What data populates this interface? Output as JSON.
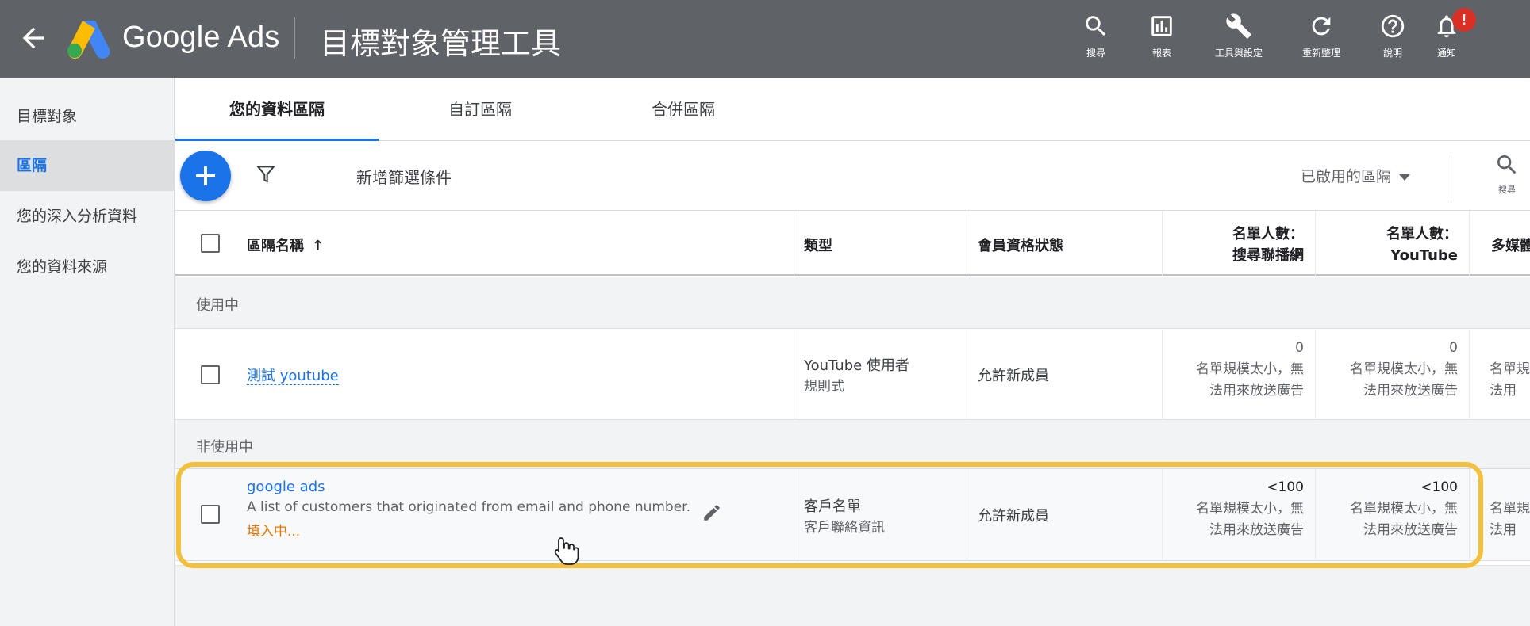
{
  "header": {
    "product": "Google Ads",
    "page_title": "目標對象管理工具",
    "tools": [
      {
        "label": "搜尋",
        "icon": "search-icon"
      },
      {
        "label": "報表",
        "icon": "reports-icon"
      },
      {
        "label": "工具與設定",
        "icon": "wrench-icon"
      },
      {
        "label": "重新整理",
        "icon": "refresh-icon"
      },
      {
        "label": "說明",
        "icon": "help-icon"
      },
      {
        "label": "通知",
        "icon": "bell-icon"
      }
    ],
    "notification_badge": "!"
  },
  "sidebar": {
    "items": [
      {
        "label": "目標對象",
        "active": false
      },
      {
        "label": "區隔",
        "active": true
      },
      {
        "label": "您的深入分析資料",
        "active": false
      },
      {
        "label": "您的資料來源",
        "active": false
      }
    ]
  },
  "tabs": [
    {
      "label": "您的資料區隔",
      "active": true
    },
    {
      "label": "自訂區隔",
      "active": false
    },
    {
      "label": "合併區隔",
      "active": false
    }
  ],
  "toolbar": {
    "add_filter_label": "新增篩選條件",
    "segment_filter": "已啟用的區隔",
    "search_label": "搜尋"
  },
  "table": {
    "columns": {
      "name": "區隔名稱",
      "type": "類型",
      "membership": "會員資格狀態",
      "size_search_line1": "名單人數：",
      "size_search_line2": "搜尋聯播網",
      "size_youtube_line1": "名單人數：",
      "size_youtube_line2": "YouTube",
      "size_display": "多媒體"
    },
    "groups": [
      {
        "label": "使用中",
        "rows": [
          {
            "name": "測試 youtube",
            "type_line1": "YouTube 使用者",
            "type_line2": "規則式",
            "membership": "允許新成員",
            "search_count": "0",
            "search_note1": "名單規模太小，無",
            "search_note2": "法用來放送廣告",
            "youtube_count": "0",
            "youtube_note1": "名單規模太小，無",
            "youtube_note2": "法用來放送廣告",
            "display_note1": "名單規",
            "display_note2": "法用"
          }
        ]
      },
      {
        "label": "非使用中",
        "rows": [
          {
            "name": "google ads",
            "description": "A list of customers that originated from email and phone number.",
            "status": "填入中...",
            "type_line1": "客戶名單",
            "type_line2": "客戶聯絡資訊",
            "membership": "允許新成員",
            "search_count": "<100",
            "search_note1": "名單規模太小，無",
            "search_note2": "法用來放送廣告",
            "youtube_count": "<100",
            "youtube_note1": "名單規模太小，無",
            "youtube_note2": "法用來放送廣告",
            "display_note1": "名單規",
            "display_note2": "法用"
          }
        ]
      }
    ]
  },
  "colors": {
    "topbar": "#5f6368",
    "accent": "#1a73e8",
    "highlight": "#f4bf3a",
    "filling": "#e37400"
  }
}
